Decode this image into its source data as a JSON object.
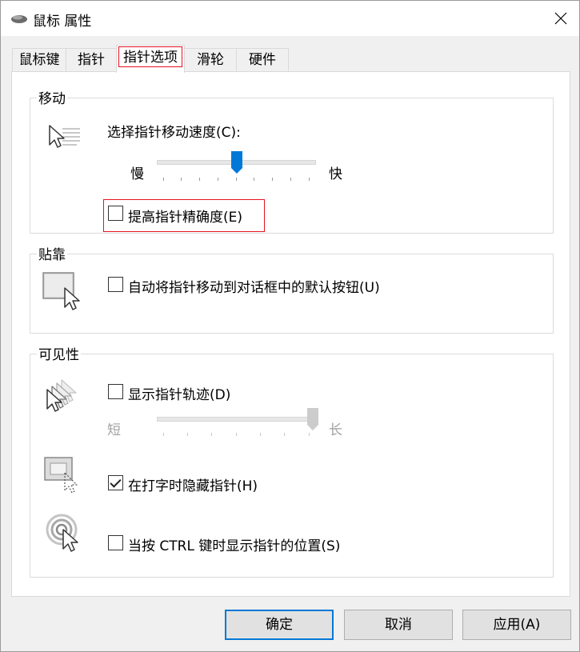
{
  "window": {
    "title": "鼠标 属性",
    "close_glyph": "✕"
  },
  "tabs": [
    {
      "label": "鼠标键",
      "active": false
    },
    {
      "label": "指针",
      "active": false
    },
    {
      "label": "指针选项",
      "active": true
    },
    {
      "label": "滑轮",
      "active": false
    },
    {
      "label": "硬件",
      "active": false
    }
  ],
  "motion": {
    "title": "移动",
    "speed_label": "选择指针移动速度(C):",
    "slow": "慢",
    "fast": "快",
    "speed_level": 0.5,
    "precision_label": "提高指针精确度(E)",
    "precision_checked": false
  },
  "snap": {
    "title": "贴靠",
    "snap_label": "自动将指针移动到对话框中的默认按钮(U)",
    "snap_checked": false
  },
  "visibility": {
    "title": "可见性",
    "trails_label": "显示指针轨迹(D)",
    "trails_checked": false,
    "short": "短",
    "long": "长",
    "trail_level": 1.0,
    "hide_label": "在打字时隐藏指针(H)",
    "hide_checked": true,
    "ctrl_label": "当按 CTRL 键时显示指针的位置(S)",
    "ctrl_checked": false
  },
  "buttons": {
    "ok": "确定",
    "cancel": "取消",
    "apply": "应用(A)"
  },
  "colors": {
    "accent": "#0078d7",
    "highlight": "#e81123"
  }
}
